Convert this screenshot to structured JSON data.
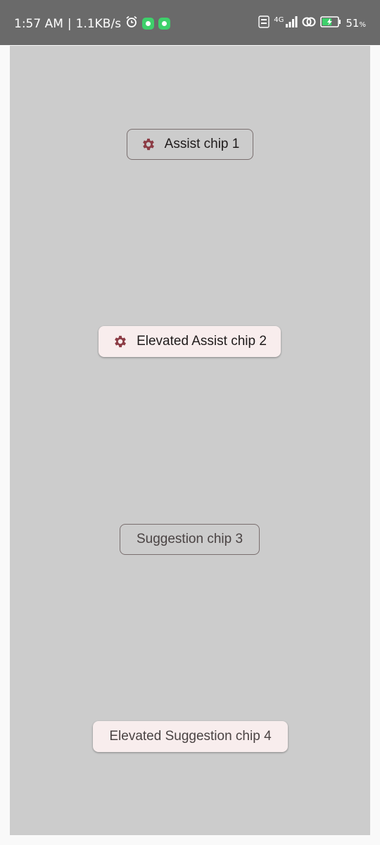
{
  "status_bar": {
    "time": "1:57 AM",
    "speed": "1.1KB/s",
    "network": "4G",
    "battery": "51",
    "battery_unit": "%"
  },
  "chips": {
    "assist_1": "Assist chip 1",
    "elevated_assist_2": "Elevated Assist chip 2",
    "suggestion_3": "Suggestion chip 3",
    "elevated_suggestion_4": "Elevated Suggestion chip 4"
  },
  "colors": {
    "panel": "#cccccc",
    "icon_accent": "#8c3c45",
    "elevated_surface": "#f8eded",
    "outline": "#7a6f6f"
  }
}
